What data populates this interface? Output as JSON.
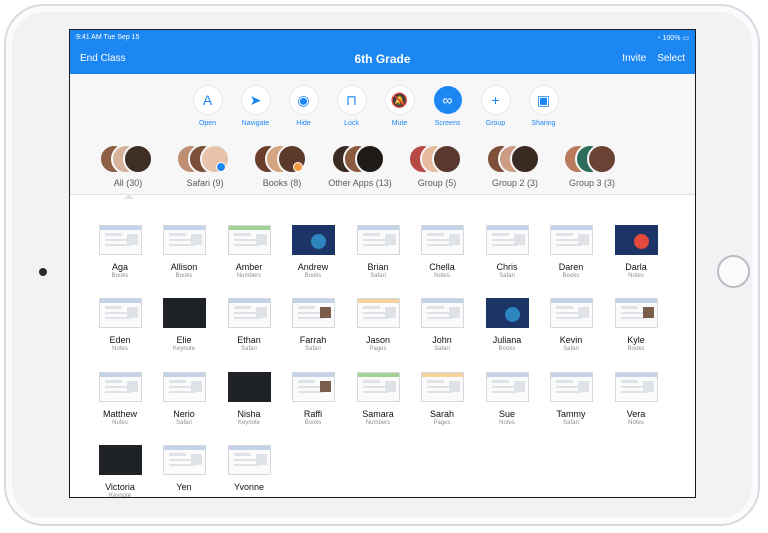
{
  "status": {
    "time": "9:41 AM",
    "date": "Tue Sep 15",
    "battery": "100%"
  },
  "navbar": {
    "end_class_label": "End Class",
    "title": "6th Grade",
    "invite_label": "Invite",
    "select_label": "Select"
  },
  "colors": {
    "accent": "#1c86f2",
    "thumbnail_keynote": "#1f2226",
    "thumbnail_biology": "#1c3566",
    "numbers_green": "#67b94c",
    "pages_orange": "#f2b95d"
  },
  "toolbar": {
    "items": [
      {
        "label": "Open",
        "icon": "app-store-icon"
      },
      {
        "label": "Navigate",
        "icon": "compass-icon"
      },
      {
        "label": "Hide",
        "icon": "eye-hide-icon"
      },
      {
        "label": "Lock",
        "icon": "lock-icon"
      },
      {
        "label": "Mute",
        "icon": "mute-icon"
      },
      {
        "label": "Screens",
        "icon": "binoculars-icon",
        "active": true
      },
      {
        "label": "Group",
        "icon": "plus-icon"
      },
      {
        "label": "Sharing",
        "icon": "share-screen-icon"
      }
    ]
  },
  "groups": [
    {
      "label": "All (30)",
      "selected": true
    },
    {
      "label": "Safari (9)"
    },
    {
      "label": "Books (8)"
    },
    {
      "label": "Other Apps (13)"
    },
    {
      "label": "Group (5)"
    },
    {
      "label": "Group 2 (3)"
    },
    {
      "label": "Group 3 (3)"
    }
  ],
  "students": [
    {
      "name": "Aga",
      "app": "Books"
    },
    {
      "name": "Allison",
      "app": "Books"
    },
    {
      "name": "Amber",
      "app": "Numbers"
    },
    {
      "name": "Andrew",
      "app": "Books"
    },
    {
      "name": "Brian",
      "app": "Safari"
    },
    {
      "name": "Chella",
      "app": "Notes"
    },
    {
      "name": "Chris",
      "app": "Safari"
    },
    {
      "name": "Daren",
      "app": "Books"
    },
    {
      "name": "Darla",
      "app": "Notes"
    },
    {
      "name": "Eden",
      "app": "Notes"
    },
    {
      "name": "Elie",
      "app": "Keynote"
    },
    {
      "name": "Ethan",
      "app": "Safari"
    },
    {
      "name": "Farrah",
      "app": "Safari"
    },
    {
      "name": "Jason",
      "app": "Pages"
    },
    {
      "name": "John",
      "app": "Safari"
    },
    {
      "name": "Juliana",
      "app": "Books"
    },
    {
      "name": "Kevin",
      "app": "Safari"
    },
    {
      "name": "Kyle",
      "app": "Books"
    },
    {
      "name": "Matthew",
      "app": "Notes"
    },
    {
      "name": "Nerio",
      "app": "Safari"
    },
    {
      "name": "Nisha",
      "app": "Keynote"
    },
    {
      "name": "Raffi",
      "app": "Books"
    },
    {
      "name": "Samara",
      "app": "Numbers"
    },
    {
      "name": "Sarah",
      "app": "Pages"
    },
    {
      "name": "Sue",
      "app": "Notes"
    },
    {
      "name": "Tammy",
      "app": "Safari"
    },
    {
      "name": "Vera",
      "app": "Notes"
    },
    {
      "name": "Victoria",
      "app": "Keynote"
    },
    {
      "name": "Yen",
      "app": ""
    },
    {
      "name": "Yvonne",
      "app": ""
    }
  ]
}
